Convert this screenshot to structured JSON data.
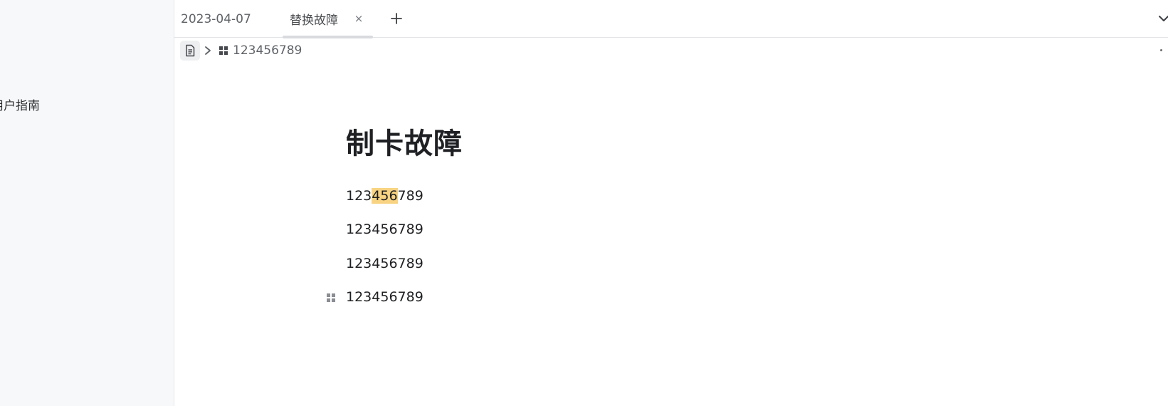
{
  "sidebar": {
    "items": [
      {
        "label": "用户指南"
      }
    ]
  },
  "tabs": [
    {
      "label": "2023-04-07",
      "active": false
    },
    {
      "label": "替换故障",
      "active": true,
      "close_glyph": "×"
    }
  ],
  "tab_icons": {
    "add": "plus-icon",
    "collapse": "chevron-down-icon"
  },
  "breadcrumb": {
    "doc_icon": "document-icon",
    "separator_icon": "chevron-right-icon",
    "block_icon": "block-grid-icon",
    "label": "123456789"
  },
  "document": {
    "title": "制卡故障",
    "paragraphs": [
      {
        "before": "123",
        "highlight": "456",
        "after": "789"
      },
      {
        "text": "123456789"
      },
      {
        "text": "123456789"
      },
      {
        "text": "123456789"
      }
    ]
  },
  "colors": {
    "highlight": "#f8d382",
    "sidebar_bg": "#f7f8fa"
  }
}
